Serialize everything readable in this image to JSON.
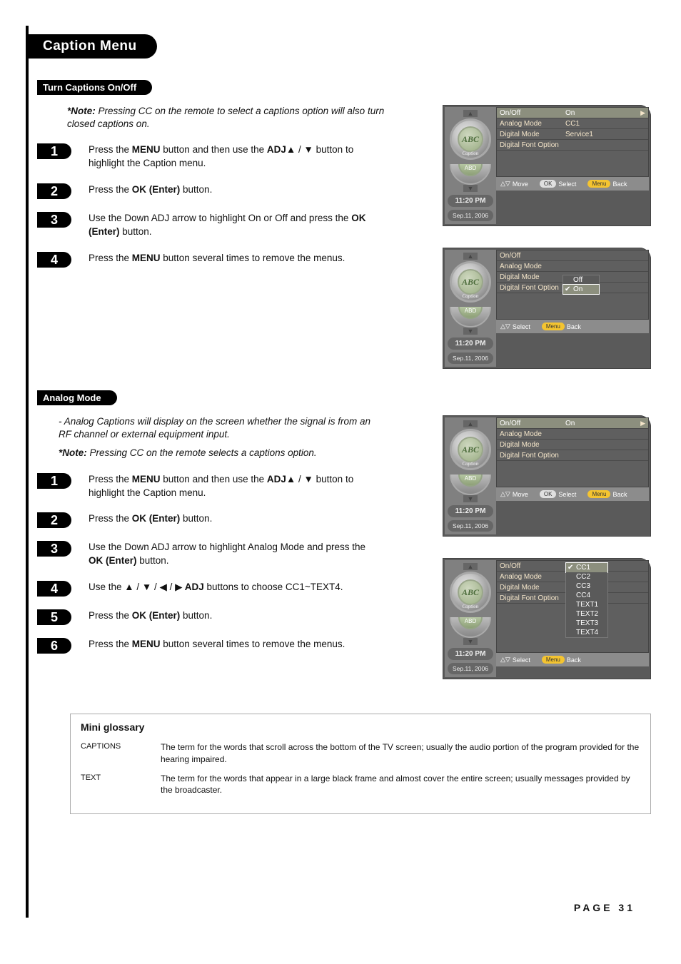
{
  "title": "Caption Menu",
  "sections": {
    "s1": {
      "heading": "Turn Captions On/Off",
      "note_bold": "*Note:",
      "note_text": " Pressing CC on the remote to select a captions option will also turn closed captions on.",
      "steps": {
        "1": {
          "pre": "Press the ",
          "b1": "MENU",
          "mid": " button and then use the ",
          "b2": "ADJ",
          "post": " button to highlight the Caption menu.",
          "arrows": " ▲ / ▼"
        },
        "2": {
          "pre": "Press the ",
          "b1": "OK (Enter)",
          "post": " button."
        },
        "3": {
          "pre": "Use the Down ADJ arrow to highlight On or Off and press the ",
          "b1": "OK (Enter)",
          "post": " button."
        },
        "4": {
          "pre": "Press the ",
          "b1": "MENU",
          "post": " button several times to remove the menus."
        }
      }
    },
    "s2": {
      "heading": "Analog Mode",
      "bullet": "- Analog Captions will display on the screen whether the signal is from an RF channel or external equipment input.",
      "note_bold": "*Note:",
      "note_text": " Pressing CC on the remote selects a captions option.",
      "steps": {
        "1": {
          "pre": "Press the ",
          "b1": "MENU",
          "mid": " button and then use the ",
          "b2": "ADJ",
          "post": " button to highlight the Caption menu.",
          "arrows": " ▲ / ▼"
        },
        "2": {
          "pre": "Press the ",
          "b1": "OK (Enter)",
          "post": " button."
        },
        "3": {
          "pre": "Use the Down ADJ arrow to highlight Analog Mode and press the ",
          "b1": "OK (Enter)",
          "post": " button."
        },
        "4": {
          "pre": "Use the ",
          "arrows": "▲ / ▼ / ◀ / ▶",
          "b1": " ADJ",
          "post": " buttons to choose CC1~TEXT4."
        },
        "5": {
          "pre": "Press the ",
          "b1": "OK (Enter)",
          "post": " button."
        },
        "6": {
          "pre": "Press the ",
          "b1": "MENU",
          "post": " button several times to remove the menus."
        }
      }
    }
  },
  "glossary": {
    "title": "Mini glossary",
    "rows": [
      {
        "term": "CAPTIONS",
        "def": "The term for the words that scroll across the bottom of the TV screen; usually the audio portion of the program provided for the hearing impaired."
      },
      {
        "term": "TEXT",
        "def": "The term for the words that appear in a large black frame and almost cover the entire screen; usually messages provided by the broadcaster."
      }
    ]
  },
  "osd": {
    "sidebar": {
      "caption": "Caption",
      "abd": "ABD",
      "abc": "ABC",
      "time": "11:20 PM",
      "date": "Sep.11, 2006"
    },
    "rows": {
      "onoff": "On/Off",
      "analog": "Analog Mode",
      "digital": "Digital Mode",
      "font": "Digital Font Option"
    },
    "vals": {
      "on": "On",
      "off": "Off",
      "cc1": "CC1",
      "svc1": "Service1"
    },
    "foot": {
      "move": "Move",
      "select": "Select",
      "back": "Back",
      "ok": "OK",
      "menu": "Menu"
    },
    "cc_options": [
      "CC1",
      "CC2",
      "CC3",
      "CC4",
      "TEXT1",
      "TEXT2",
      "TEXT3",
      "TEXT4"
    ],
    "onoff_options": [
      "Off",
      "On"
    ]
  },
  "page_no": "PAGE 31"
}
